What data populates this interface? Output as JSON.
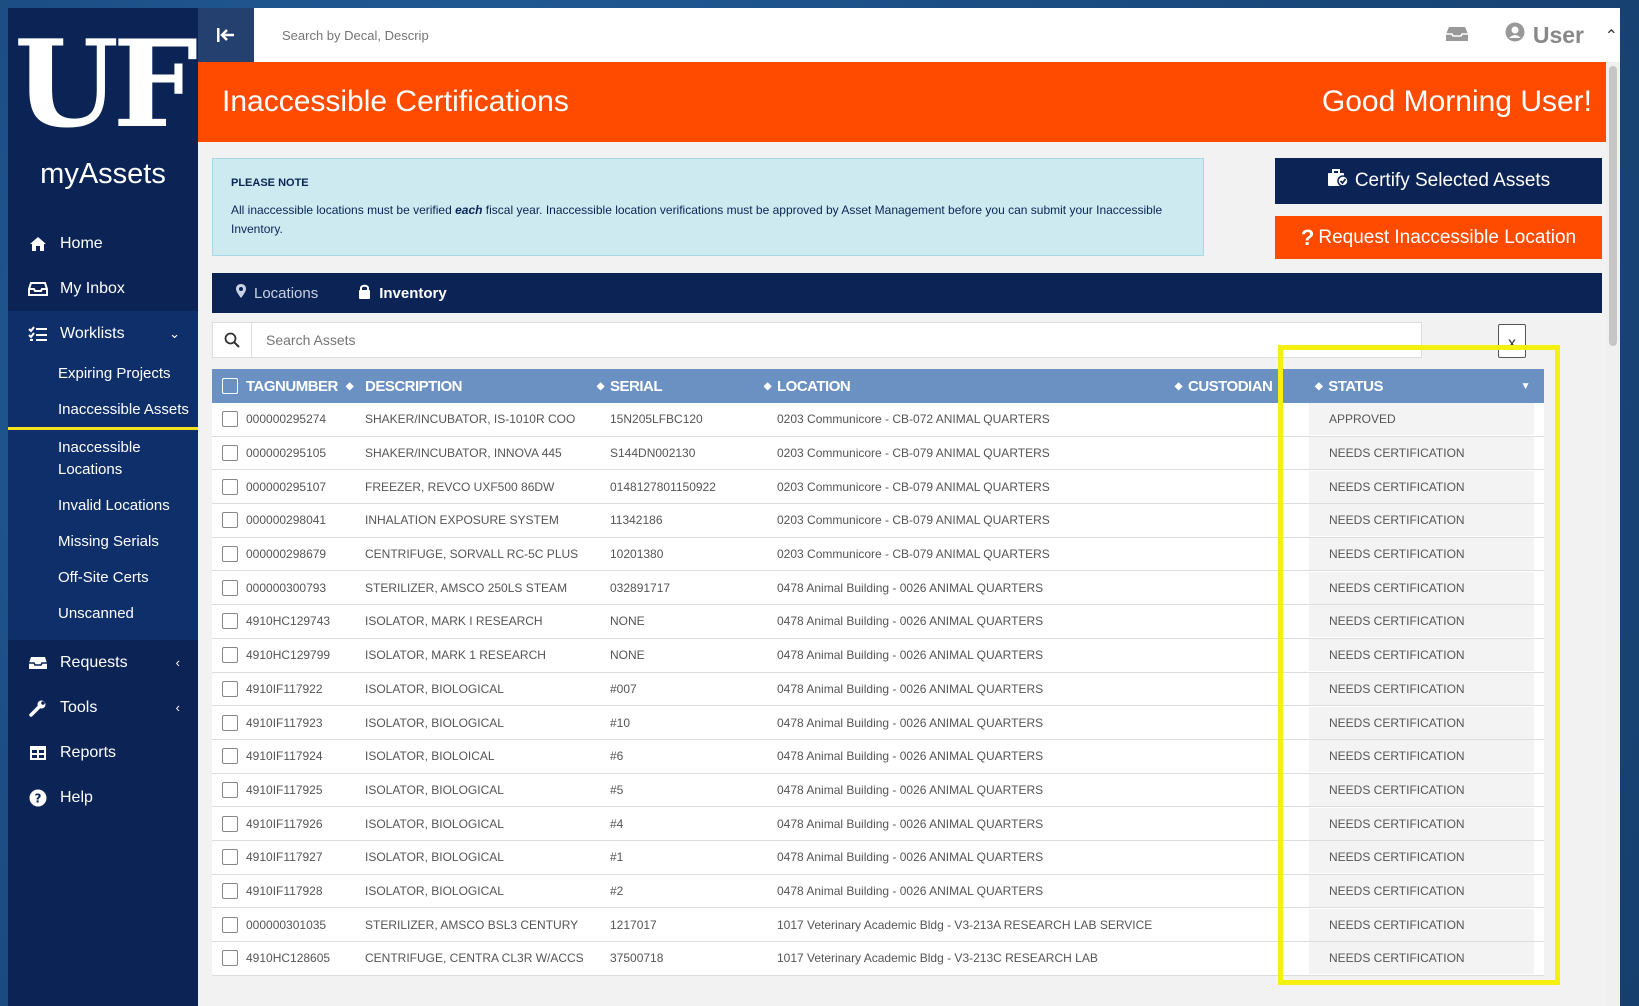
{
  "sidebar": {
    "logo": "UF",
    "app_name": "myAssets",
    "items": [
      {
        "label": "Home",
        "icon": "home-icon"
      },
      {
        "label": "My Inbox",
        "icon": "inbox-icon"
      },
      {
        "label": "Worklists",
        "icon": "list-icon",
        "expanded": true,
        "sub": [
          {
            "label": "Expiring Projects"
          },
          {
            "label": "Inaccessible Assets",
            "active": true
          },
          {
            "label": "Inaccessible Locations"
          },
          {
            "label": "Invalid Locations"
          },
          {
            "label": "Missing Serials"
          },
          {
            "label": "Off-Site Certs"
          },
          {
            "label": "Unscanned"
          }
        ]
      },
      {
        "label": "Requests",
        "icon": "inbox-icon"
      },
      {
        "label": "Tools",
        "icon": "wrench-icon"
      },
      {
        "label": "Reports",
        "icon": "table-icon"
      },
      {
        "label": "Help",
        "icon": "help-icon"
      }
    ]
  },
  "topbar": {
    "search_placeholder": "Search by Decal, Descrip",
    "user_label": "User"
  },
  "banner": {
    "title": "Inaccessible Certifications",
    "greeting": "Good Morning User!"
  },
  "note": {
    "heading": "PLEASE NOTE",
    "body_pre": "All inaccessible locations must be verified ",
    "body_em": "each",
    "body_post": " fiscal year. Inaccessible location verifications must be approved by Asset Management before you can submit your Inaccessible Inventory."
  },
  "actions": {
    "certify": "Certify Selected Assets",
    "request": "Request Inaccessible Location"
  },
  "tabs": [
    {
      "label": "Locations",
      "active": false
    },
    {
      "label": "Inventory",
      "active": true
    }
  ],
  "asset_search": {
    "placeholder": "Search Assets"
  },
  "table": {
    "headers": {
      "tag": "TAGNUMBER",
      "desc": "DESCRIPTION",
      "serial": "SERIAL",
      "loc": "LOCATION",
      "cust": "CUSTODIAN",
      "status": "STATUS"
    },
    "rows": [
      {
        "tag": "000000295274",
        "desc": "SHAKER/INCUBATOR, IS-1010R COO",
        "serial": "15N205LFBC120",
        "loc": "0203 Communicore - CB-072 ANIMAL QUARTERS",
        "status": "APPROVED"
      },
      {
        "tag": "000000295105",
        "desc": "SHAKER/INCUBATOR, INNOVA 445",
        "serial": "S144DN002130",
        "loc": "0203 Communicore - CB-079 ANIMAL QUARTERS",
        "status": "NEEDS CERTIFICATION"
      },
      {
        "tag": "000000295107",
        "desc": "FREEZER, REVCO UXF500 86DW",
        "serial": "0148127801150922",
        "loc": "0203 Communicore - CB-079 ANIMAL QUARTERS",
        "status": "NEEDS CERTIFICATION"
      },
      {
        "tag": "000000298041",
        "desc": "INHALATION EXPOSURE SYSTEM",
        "serial": "11342186",
        "loc": "0203 Communicore - CB-079 ANIMAL QUARTERS",
        "status": "NEEDS CERTIFICATION"
      },
      {
        "tag": "000000298679",
        "desc": "CENTRIFUGE, SORVALL RC-5C PLUS",
        "serial": "10201380",
        "loc": "0203 Communicore - CB-079 ANIMAL QUARTERS",
        "status": "NEEDS CERTIFICATION"
      },
      {
        "tag": "000000300793",
        "desc": "STERILIZER, AMSCO 250LS STEAM",
        "serial": "032891717",
        "loc": "0478 Animal Building - 0026 ANIMAL QUARTERS",
        "status": "NEEDS CERTIFICATION"
      },
      {
        "tag": "4910HC129743",
        "desc": "ISOLATOR, MARK I RESEARCH",
        "serial": "NONE",
        "loc": "0478 Animal Building - 0026 ANIMAL QUARTERS",
        "status": "NEEDS CERTIFICATION"
      },
      {
        "tag": "4910HC129799",
        "desc": "ISOLATOR, MARK 1 RESEARCH",
        "serial": "NONE",
        "loc": "0478 Animal Building - 0026 ANIMAL QUARTERS",
        "status": "NEEDS CERTIFICATION"
      },
      {
        "tag": "4910IF117922",
        "desc": "ISOLATOR, BIOLOGICAL",
        "serial": "#007",
        "loc": "0478 Animal Building - 0026 ANIMAL QUARTERS",
        "status": "NEEDS CERTIFICATION"
      },
      {
        "tag": "4910IF117923",
        "desc": "ISOLATOR, BIOLOGICAL",
        "serial": "#10",
        "loc": "0478 Animal Building - 0026 ANIMAL QUARTERS",
        "status": "NEEDS CERTIFICATION"
      },
      {
        "tag": "4910IF117924",
        "desc": "ISOLATOR, BIOLOICAL",
        "serial": "#6",
        "loc": "0478 Animal Building - 0026 ANIMAL QUARTERS",
        "status": "NEEDS CERTIFICATION"
      },
      {
        "tag": "4910IF117925",
        "desc": "ISOLATOR, BIOLOGICAL",
        "serial": "#5",
        "loc": "0478 Animal Building - 0026 ANIMAL QUARTERS",
        "status": "NEEDS CERTIFICATION"
      },
      {
        "tag": "4910IF117926",
        "desc": "ISOLATOR, BIOLOGICAL",
        "serial": "#4",
        "loc": "0478 Animal Building - 0026 ANIMAL QUARTERS",
        "status": "NEEDS CERTIFICATION"
      },
      {
        "tag": "4910IF117927",
        "desc": "ISOLATOR, BIOLOGICAL",
        "serial": "#1",
        "loc": "0478 Animal Building - 0026 ANIMAL QUARTERS",
        "status": "NEEDS CERTIFICATION"
      },
      {
        "tag": "4910IF117928",
        "desc": "ISOLATOR, BIOLOGICAL",
        "serial": "#2",
        "loc": "0478 Animal Building - 0026 ANIMAL QUARTERS",
        "status": "NEEDS CERTIFICATION"
      },
      {
        "tag": "000000301035",
        "desc": "STERILIZER, AMSCO BSL3 CENTURY",
        "serial": "1217017",
        "loc": "1017 Veterinary Academic Bldg - V3-213A RESEARCH LAB SERVICE",
        "status": "NEEDS CERTIFICATION"
      },
      {
        "tag": "4910HC128605",
        "desc": "CENTRIFUGE, CENTRA CL3R W/ACCS",
        "serial": "37500718",
        "loc": "1017 Veterinary Academic Bldg - V3-213C RESEARCH LAB",
        "status": "NEEDS CERTIFICATION"
      }
    ]
  },
  "colors": {
    "navy": "#0b2455",
    "orange": "#ff4b00",
    "header_blue": "#6b91c3",
    "highlight": "#f6f010"
  }
}
